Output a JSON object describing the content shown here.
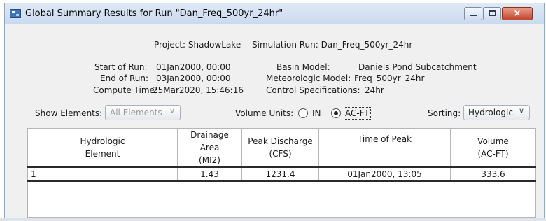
{
  "window": {
    "title": "Global Summary Results for Run \"Dan_Freq_500yr_24hr\"",
    "close_label": "×"
  },
  "header": {
    "project": "Project: ShadowLake",
    "simulation_run": "Simulation Run: Dan_Freq_500yr_24hr"
  },
  "run_info": {
    "start_label": "Start of Run:",
    "start_value": "01Jan2000, 00:00",
    "end_label": "End of Run:",
    "end_value": "03Jan2000, 00:00",
    "compute_label": "Compute Time:",
    "compute_value": "25Mar2020, 15:46:16",
    "basin_label": "Basin Model:",
    "basin_value": "Daniels Pond Subcatchment",
    "met_label": "Meteorologic Model:",
    "met_value": "Freq_500yr_24hr",
    "control_label": "Control Specifications:",
    "control_value": "24hr"
  },
  "controls": {
    "show_elements_label": "Show Elements:",
    "show_elements_value": "All Elements",
    "volume_units_label": "Volume Units:",
    "unit_in": "IN",
    "unit_acft": "AC-FT",
    "selected_unit": "AC-FT",
    "sorting_label": "Sorting:",
    "sorting_value": "Hydrologic"
  },
  "table": {
    "headers": [
      {
        "line1": "Hydrologic",
        "line2": "Element"
      },
      {
        "line1": "Drainage Area",
        "line2": "(MI2)"
      },
      {
        "line1": "Peak Discharge",
        "line2": "(CFS)"
      },
      {
        "line1": "Time of Peak",
        "line2": ""
      },
      {
        "line1": "Volume",
        "line2": "(AC-FT)"
      }
    ],
    "rows": [
      {
        "element": "1",
        "area": "1.43",
        "discharge": "1231.4",
        "time": "01Jan2000, 13:05",
        "volume": "333.6"
      }
    ]
  }
}
